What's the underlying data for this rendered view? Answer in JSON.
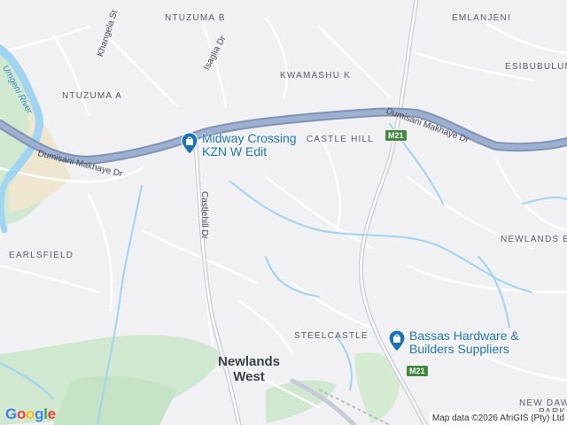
{
  "areas": {
    "ntuzuma_b": "NTUZUMA B",
    "emlanjeni": "EMLANJENI",
    "esibubulungu": "ESIBUBULUN",
    "kwamashu_k": "KWAMASHU K",
    "ntuzuma_a": "NTUZUMA A",
    "castle_hill": "CASTLE HILL",
    "newlands_east": "NEWLANDS EA",
    "earlsfield": "EARLSFIELD",
    "steelcastle": "STEELCASTLE",
    "newlands_west_1": "Newlands",
    "newlands_west_2": "West",
    "new_dawn_1": "NEW DAWN",
    "new_dawn_2": "PARK"
  },
  "streets": {
    "khangela": "Khangela St",
    "isaglia": "Isaglia Dr",
    "dumisani_left": "Dumisani Makhaye Dr",
    "dumisani_right": "Dumisani Makhaye Dr",
    "castlehill": "Castlehill Dr"
  },
  "water": {
    "umgeni": "Umgeni River"
  },
  "shields": {
    "m21_top": "M21",
    "m21_bottom": "M21"
  },
  "pois": {
    "midway_1": "Midway Crossing",
    "midway_2": "KZN W Edit",
    "bassas_1": "Bassas Hardware &",
    "bassas_2": "Builders Suppliers",
    "icon": "shopping-bag-icon"
  },
  "footer": {
    "logo": "Google",
    "attribution": "Map data ©2026 AfriGIS (Pty) Ltd"
  },
  "colors": {
    "land": "#f1f1f4",
    "park": "#cfe8cf",
    "water": "#9fd4f2",
    "highway": "#8fa3c2",
    "poi": "#1a73b8"
  }
}
